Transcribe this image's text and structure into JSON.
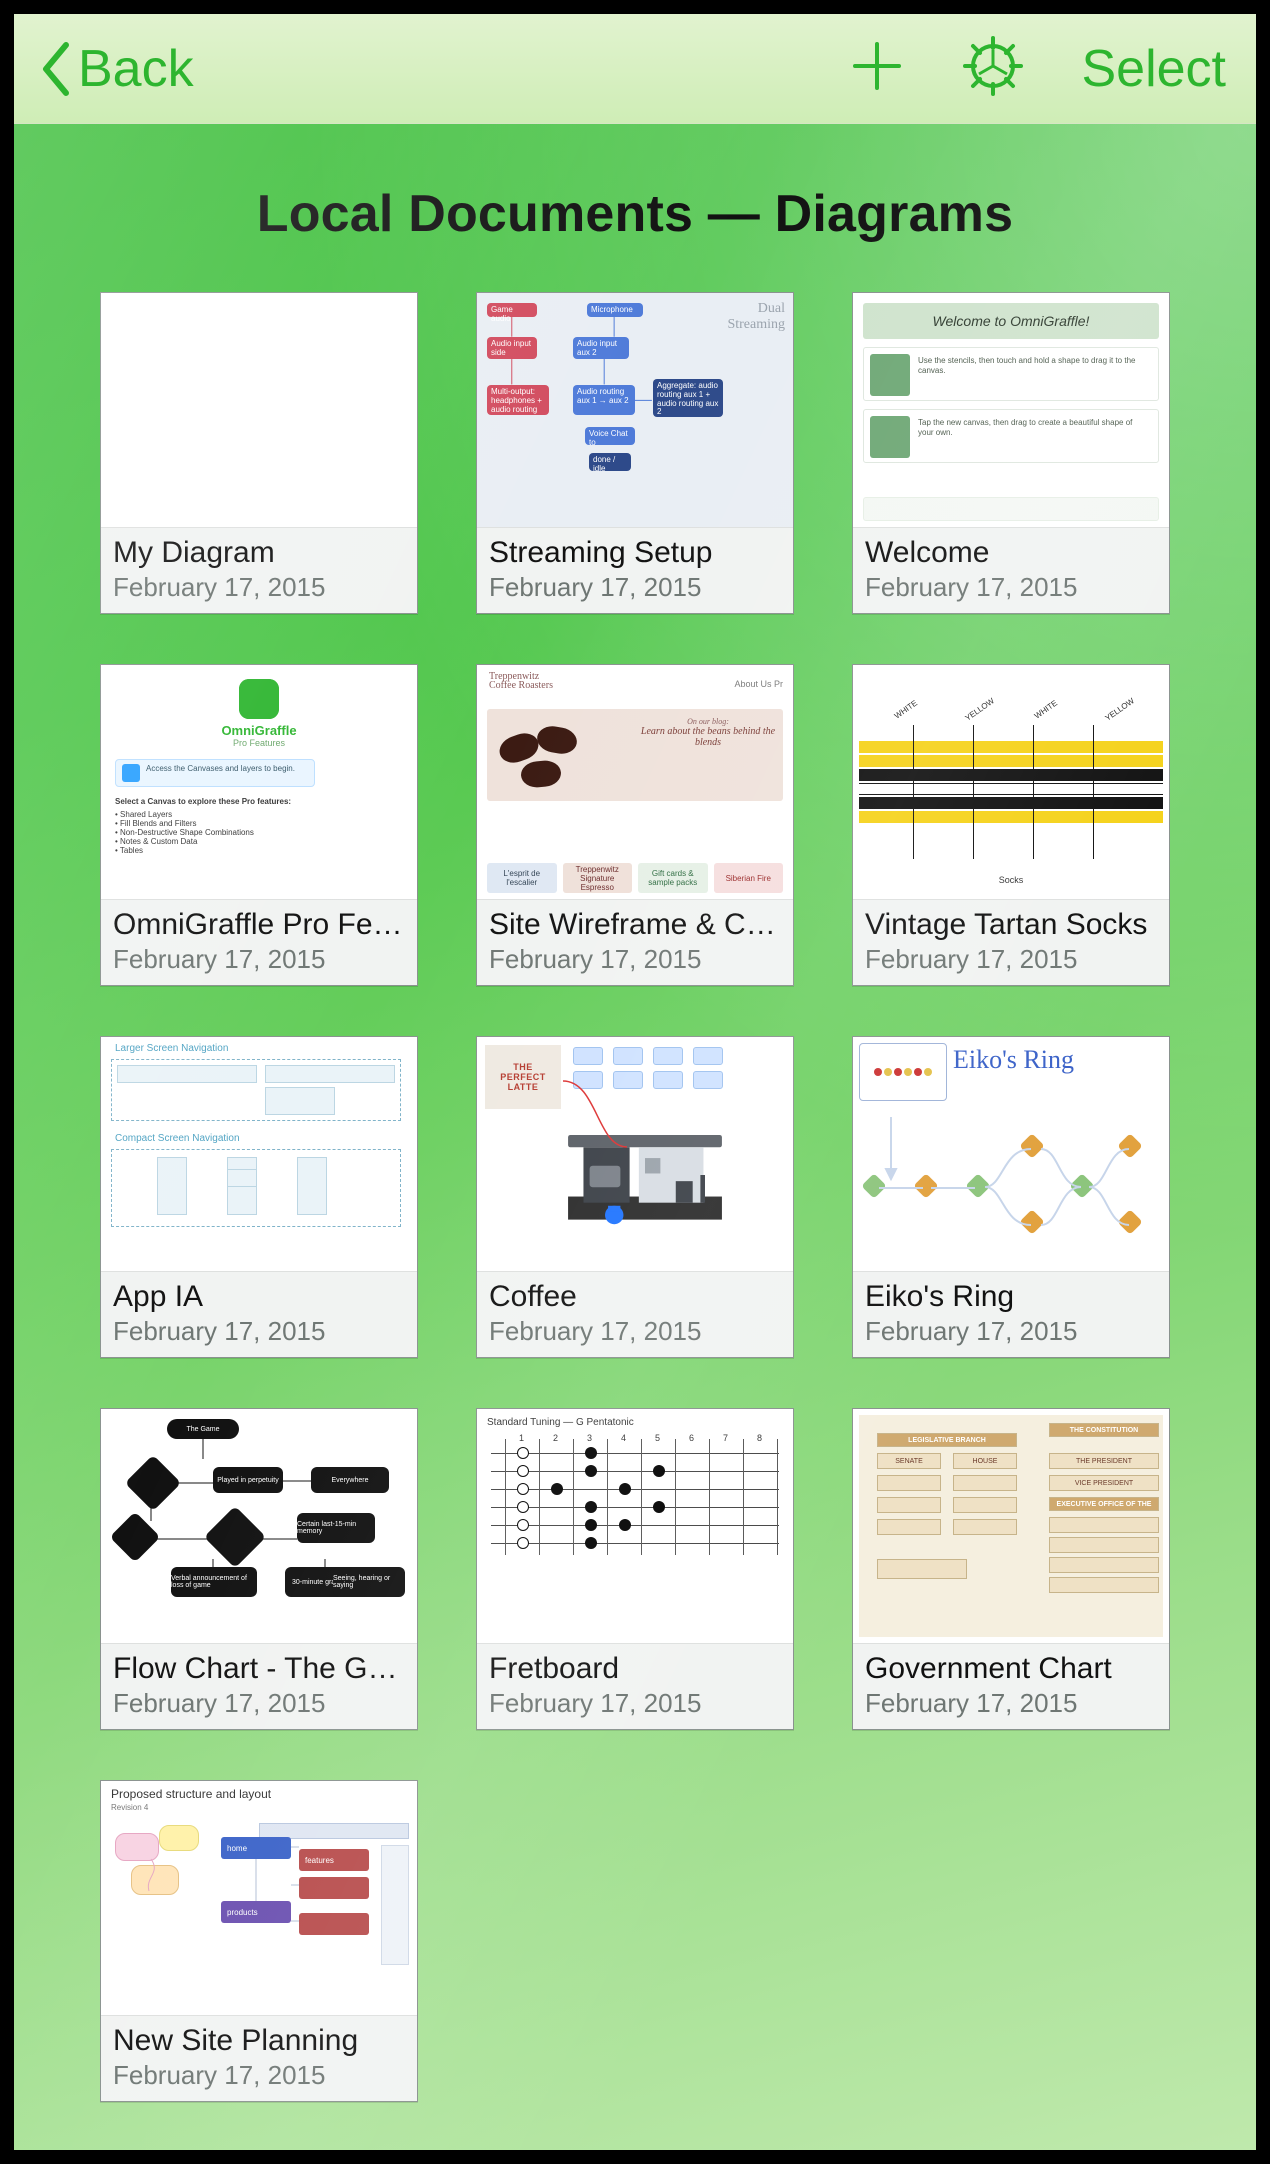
{
  "colors": {
    "accent": "#2db52f"
  },
  "navbar": {
    "back_label": "Back",
    "select_label": "Select"
  },
  "page": {
    "title": "Local Documents — Diagrams"
  },
  "documents": [
    {
      "title": "My Diagram",
      "date": "February 17, 2015"
    },
    {
      "title": "Streaming Setup",
      "date": "February 17, 2015"
    },
    {
      "title": "Welcome",
      "date": "February 17, 2015"
    },
    {
      "title": "OmniGraffle Pro Features",
      "date": "February 17, 2015"
    },
    {
      "title": "Site Wireframe & Content",
      "date": "February 17, 2015"
    },
    {
      "title": "Vintage Tartan Socks",
      "date": "February 17, 2015"
    },
    {
      "title": "App IA",
      "date": "February 17, 2015"
    },
    {
      "title": "Coffee",
      "date": "February 17, 2015"
    },
    {
      "title": "Eiko's Ring",
      "date": "February 17, 2015"
    },
    {
      "title": "Flow Chart - The Game",
      "date": "February 17, 2015"
    },
    {
      "title": "Fretboard",
      "date": "February 17, 2015"
    },
    {
      "title": "Government Chart",
      "date": "February 17, 2015"
    },
    {
      "title": "New Site Planning",
      "date": "February 17, 2015"
    }
  ],
  "thumbs": {
    "welcome_header": "Welcome to OmniGraffle!",
    "pro_brand": "OmniGraffle",
    "pro_sub": "Pro Features",
    "pro_cta": "Access the Canvases and layers to begin.",
    "pro_list_title": "Select a Canvas to explore these Pro features:",
    "pro_items": [
      "Shared Layers",
      "Fill Blends and Filters",
      "Non-Destructive Shape Combinations",
      "Notes & Custom Data",
      "Tables"
    ],
    "wire_brand": "Treppenwitz",
    "wire_brand_sub": "Coffee Roasters",
    "wire_menu": "About Us     Pr",
    "wire_blog": "On our blog:",
    "wire_quote": "Learn about the beans behind the blends",
    "wire_tabs": [
      "L'esprit de l'escalier",
      "Treppenwitz Signature Espresso",
      "Gift cards & sample packs",
      "Siberian Fire"
    ],
    "ia_cap1": "Larger Screen Navigation",
    "ia_cap2": "Compact Screen Navigation",
    "coffee_poster_1": "THE",
    "coffee_poster_2": "PERFECT",
    "coffee_poster_3": "LATTE",
    "eiko_title": "Eiko's Ring",
    "fret_title": "Standard Tuning — G Pentatonic",
    "fret_positions": [
      "1",
      "2",
      "3",
      "4",
      "5",
      "6",
      "7",
      "8"
    ],
    "tartan_labels": [
      "WHITE",
      "YELLOW",
      "WHITE",
      "YELLOW"
    ],
    "tartan_foot": "Socks",
    "gov_hd_left": "LEGISLATIVE BRANCH",
    "gov_hd_right": "THE CONSTITUTION",
    "plan_h1": "Proposed structure and layout",
    "plan_h2": "Revision 4"
  }
}
